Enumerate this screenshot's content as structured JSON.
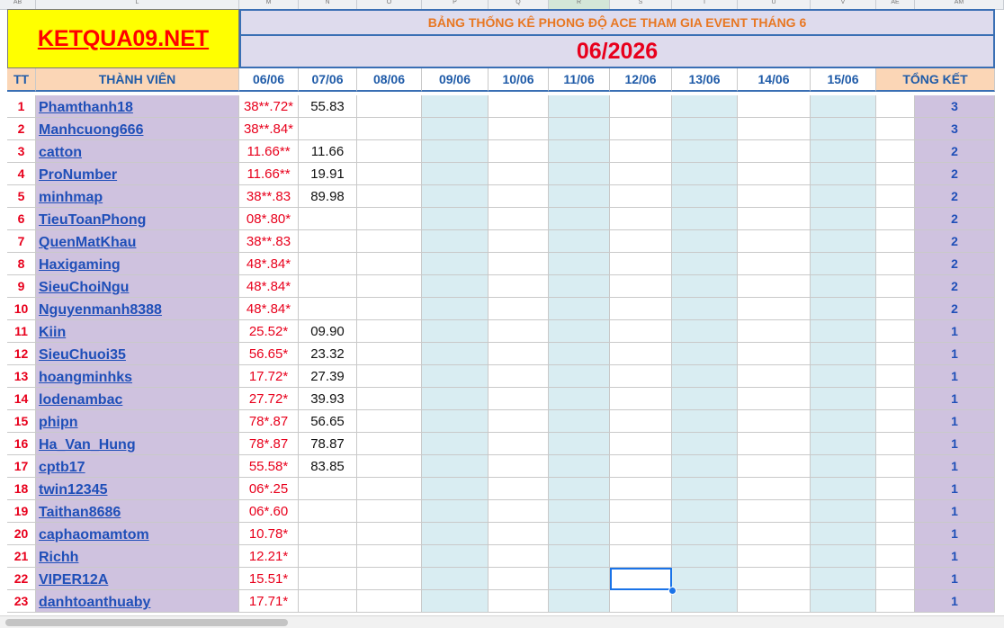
{
  "column_letters": [
    "AB",
    "L",
    "M",
    "N",
    "O",
    "P",
    "Q",
    "R",
    "S",
    "T",
    "U",
    "V",
    "AE",
    "AM"
  ],
  "logo_text": "KETQUA09.NET",
  "banner_title": "BẢNG THỐNG KÊ PHONG ĐỘ ACE THAM GIA EVENT THÁNG 6",
  "month_label": "06/2026",
  "headers": {
    "tt": "TT",
    "member": "THÀNH VIÊN",
    "dates": [
      "06/06",
      "07/06",
      "08/06",
      "09/06",
      "10/06",
      "11/06",
      "12/06",
      "13/06",
      "14/06",
      "15/06"
    ],
    "total": "TỔNG KẾT"
  },
  "rows": [
    {
      "tt": "1",
      "name": "Phamthanh18",
      "d1": "38**.72*",
      "d2": "55.83",
      "total": "3"
    },
    {
      "tt": "2",
      "name": "Manhcuong666",
      "d1": "38**.84*",
      "d2": "",
      "total": "3"
    },
    {
      "tt": "3",
      "name": "catton",
      "d1": "11.66**",
      "d2": "11.66",
      "total": "2"
    },
    {
      "tt": "4",
      "name": "ProNumber",
      "d1": "11.66**",
      "d2": "19.91",
      "total": "2"
    },
    {
      "tt": "5",
      "name": "minhmap",
      "d1": "38**.83",
      "d2": "89.98",
      "total": "2"
    },
    {
      "tt": "6",
      "name": "TieuToanPhong",
      "d1": "08*.80*",
      "d2": "",
      "total": "2"
    },
    {
      "tt": "7",
      "name": "QuenMatKhau",
      "d1": "38**.83",
      "d2": "",
      "total": "2"
    },
    {
      "tt": "8",
      "name": "Haxigaming",
      "d1": "48*.84*",
      "d2": "",
      "total": "2"
    },
    {
      "tt": "9",
      "name": "SieuChoiNgu",
      "d1": "48*.84*",
      "d2": "",
      "total": "2"
    },
    {
      "tt": "10",
      "name": "Nguyenmanh8388",
      "d1": "48*.84*",
      "d2": "",
      "total": "2"
    },
    {
      "tt": "11",
      "name": "Kiin",
      "d1": "25.52*",
      "d2": "09.90",
      "total": "1"
    },
    {
      "tt": "12",
      "name": "SieuChuoi35",
      "d1": "56.65*",
      "d2": "23.32",
      "total": "1"
    },
    {
      "tt": "13",
      "name": "hoangminhks",
      "d1": "17.72*",
      "d2": "27.39",
      "total": "1"
    },
    {
      "tt": "14",
      "name": "lodenambac",
      "d1": "27.72*",
      "d2": "39.93",
      "total": "1"
    },
    {
      "tt": "15",
      "name": "phipn",
      "d1": "78*.87",
      "d2": "56.65",
      "total": "1"
    },
    {
      "tt": "16",
      "name": "Ha_Van_Hung",
      "d1": "78*.87",
      "d2": "78.87",
      "total": "1"
    },
    {
      "tt": "17",
      "name": "cptb17",
      "d1": "55.58*",
      "d2": "83.85",
      "total": "1"
    },
    {
      "tt": "18",
      "name": "twin12345",
      "d1": "06*.25",
      "d2": "",
      "total": "1"
    },
    {
      "tt": "19",
      "name": "Taithan8686",
      "d1": "06*.60",
      "d2": "",
      "total": "1"
    },
    {
      "tt": "20",
      "name": "caphaomamtom",
      "d1": "10.78*",
      "d2": "",
      "total": "1"
    },
    {
      "tt": "21",
      "name": "Richh",
      "d1": "12.21*",
      "d2": "",
      "total": "1"
    },
    {
      "tt": "22",
      "name": "VIPER12A",
      "d1": "15.51*",
      "d2": "",
      "total": "1"
    },
    {
      "tt": "23",
      "name": "danhtoanthuaby",
      "d1": "17.71*",
      "d2": "",
      "total": "1"
    }
  ],
  "colors": {
    "logo_bg": "#ffff00",
    "logo_text": "#ff0000",
    "banner_text": "#e87722",
    "month_text": "#e8001c",
    "header_text": "#1f5ba8",
    "name_bg": "#cfc2df",
    "teal_column": "#d9edf2",
    "selection": "#1a73e8"
  }
}
